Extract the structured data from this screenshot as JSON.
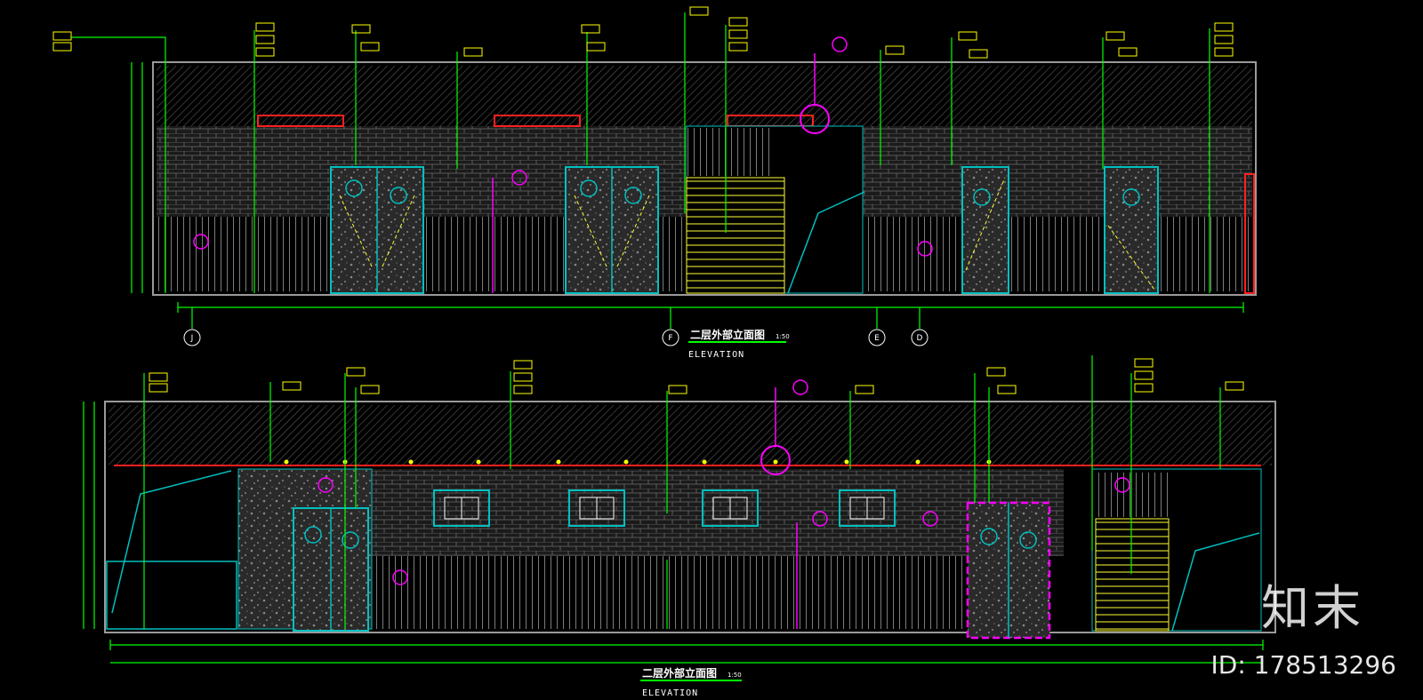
{
  "drawing_top": {
    "title": "二层外部立面图",
    "scale_note": "1:50",
    "subtitle": "ELEVATION",
    "grid_labels": [
      "J",
      "F",
      "E",
      "D"
    ]
  },
  "drawing_bottom": {
    "title": "二层外部立面图",
    "scale_note": "1:50",
    "subtitle": "ELEVATION"
  },
  "watermark": {
    "brand": "知末",
    "id_text": "ID: 178513296"
  },
  "colors": {
    "background": "#000000",
    "leader": "#00ff00",
    "tag": "#ffff00",
    "outline": "#00c0c0",
    "hatch": "#8a8a8a",
    "accent_red": "#ff2020",
    "section_marker": "#ff00ff"
  }
}
